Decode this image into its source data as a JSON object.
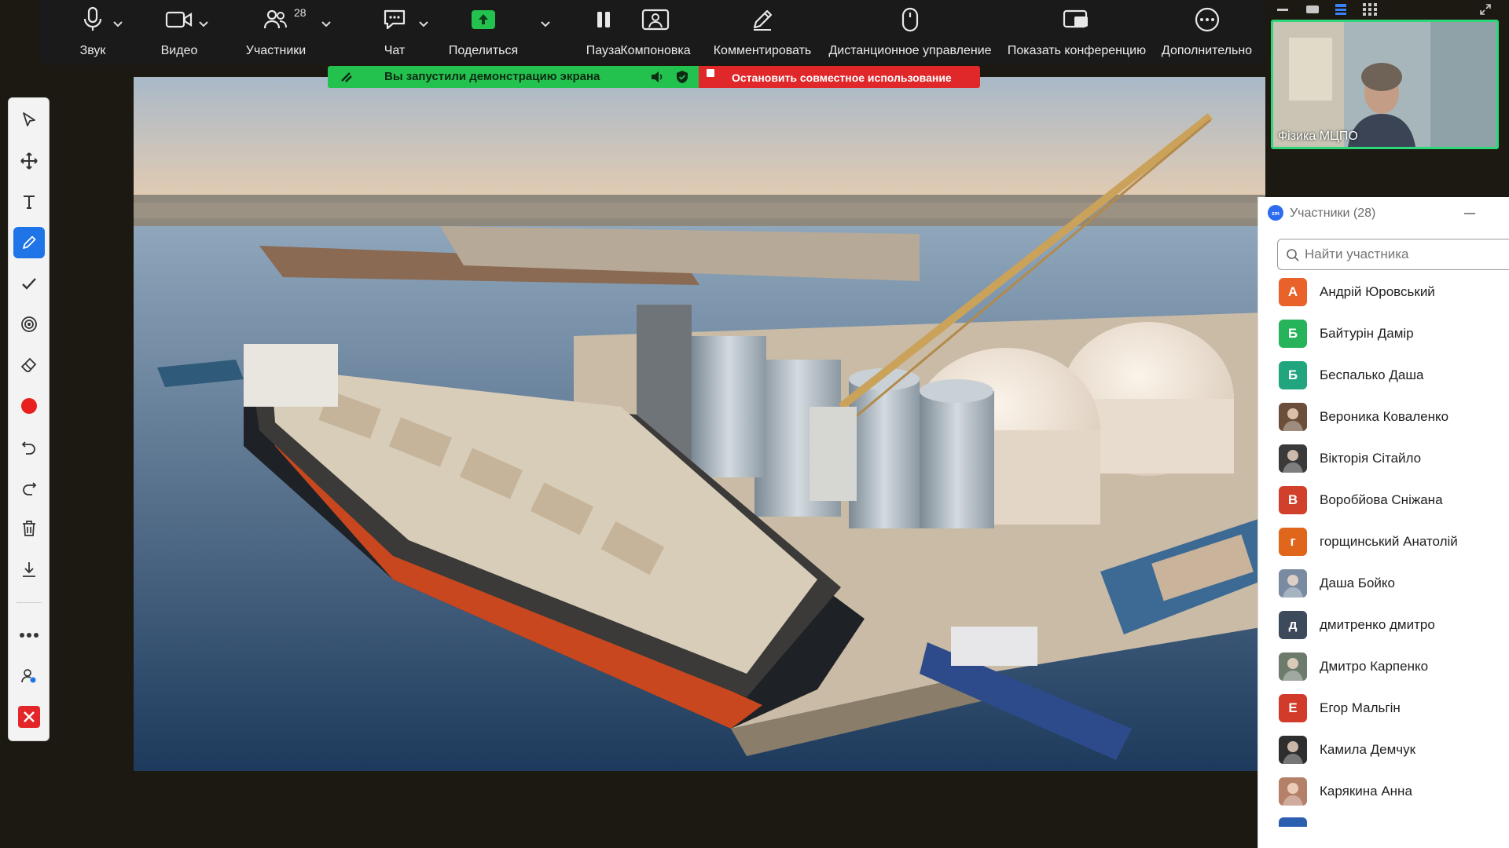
{
  "toolbar": {
    "audio_label": "Звук",
    "video_label": "Видео",
    "participants_label": "Участники",
    "participants_count": "28",
    "chat_label": "Чат",
    "share_label": "Поделиться",
    "pause_label": "Пауза",
    "layout_label": "Компоновка",
    "annotate_label": "Комментировать",
    "remote_label": "Дистанционное управление",
    "show_meeting_label": "Показать конференцию",
    "more_label": "Дополнительно"
  },
  "share_banner": {
    "status_text": "Вы запустили демонстрацию экрана",
    "stop_text": "Остановить совместное использование"
  },
  "self_view": {
    "name": "Фізика МЦПО"
  },
  "participants_panel": {
    "title": "Участники (28)",
    "search_placeholder": "Найти участника",
    "items": [
      {
        "initial": "А",
        "name": "Андрій Юровський",
        "color": "#e8622a",
        "avatar": "letter"
      },
      {
        "initial": "Б",
        "name": "Байтурін Дамір",
        "color": "#27b35a",
        "avatar": "letter"
      },
      {
        "initial": "Б",
        "name": "Беспалько Даша",
        "color": "#21a57e",
        "avatar": "letter"
      },
      {
        "initial": "",
        "name": "Вероника Коваленко",
        "color": "#6b4f3a",
        "avatar": "photo"
      },
      {
        "initial": "",
        "name": "Вікторія Сітайло",
        "color": "#3a3a3a",
        "avatar": "photo"
      },
      {
        "initial": "В",
        "name": "Воробйова Сніжана",
        "color": "#d0402a",
        "avatar": "letter"
      },
      {
        "initial": "г",
        "name": "горщинський Анатолій",
        "color": "#e0661c",
        "avatar": "letter"
      },
      {
        "initial": "",
        "name": "Даша Бойко",
        "color": "#7a8aa0",
        "avatar": "photo"
      },
      {
        "initial": "д",
        "name": "дмитренко дмитро",
        "color": "#3d4a5c",
        "avatar": "letter"
      },
      {
        "initial": "",
        "name": "Дмитро Карпенко",
        "color": "#6d7b6d",
        "avatar": "photo"
      },
      {
        "initial": "Е",
        "name": "Егор Мальгін",
        "color": "#d23b2a",
        "avatar": "letter"
      },
      {
        "initial": "",
        "name": "Камила Демчук",
        "color": "#2e2e2e",
        "avatar": "photo"
      },
      {
        "initial": "",
        "name": "Карякина Анна",
        "color": "#b5806a",
        "avatar": "photo"
      }
    ]
  },
  "colors": {
    "toolbar_bg": "#1a1a1a",
    "share_green": "#23c14e",
    "stop_red": "#e0272a",
    "active_video_border": "#2ed67a",
    "annotate_active": "#1f74e8"
  }
}
